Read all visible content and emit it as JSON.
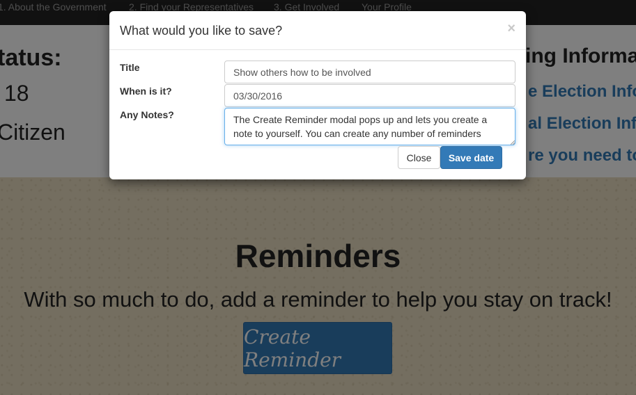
{
  "navbar": {
    "items": [
      {
        "label": "1. About the Government"
      },
      {
        "label": "2. Find your Representatives"
      },
      {
        "label": "3. Get Involved"
      },
      {
        "label": "Your Profile"
      }
    ]
  },
  "status": {
    "title": "tatus:",
    "age": "18",
    "citizen": "Citizen"
  },
  "voting_info": {
    "title": "ing Informa",
    "links": [
      {
        "label": "e Election Infor"
      },
      {
        "label": "al Election Infor"
      },
      {
        "label": "re you need to"
      }
    ]
  },
  "reminders": {
    "title": "Reminders",
    "subtitle": "With so much to do, add a reminder to help you stay on track!",
    "button_label": "Create Reminder"
  },
  "modal": {
    "title": "What would you like to save?",
    "close_icon": "×",
    "fields": {
      "title_label": "Title",
      "title_value": "Show others how to be involved",
      "date_label": "When is it?",
      "date_value": "03/30/2016",
      "notes_label": "Any Notes?",
      "notes_value": "The Create Reminder modal pops up and lets you create a note to yourself. You can create any number of reminders"
    },
    "close_button": "Close",
    "save_button": "Save date"
  },
  "colors": {
    "primary": "#337ab7",
    "navbar": "#222222",
    "backdrop": "rgba(0,0,0,0.5)"
  }
}
